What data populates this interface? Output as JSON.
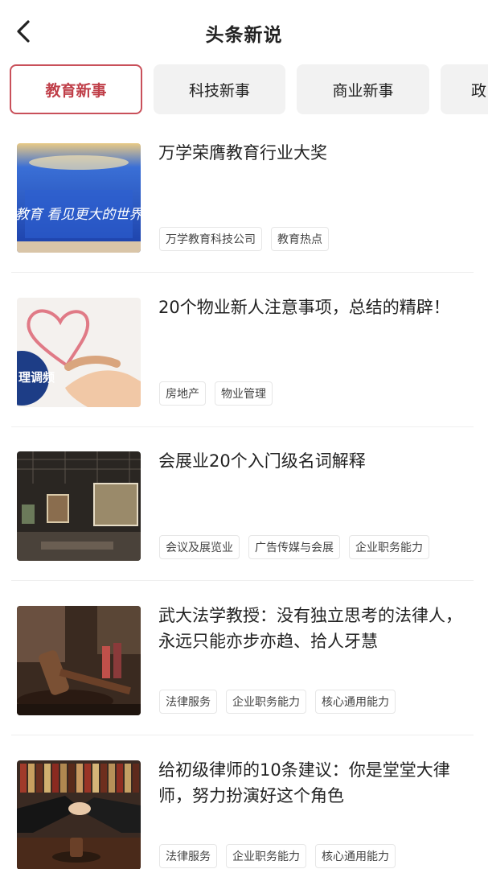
{
  "header": {
    "title": "头条新说",
    "back_icon": "chevron-left-icon"
  },
  "tabs": [
    {
      "label": "教育新事",
      "active": true
    },
    {
      "label": "科技新事",
      "active": false
    },
    {
      "label": "商业新事",
      "active": false
    },
    {
      "label": "政",
      "active": false
    }
  ],
  "articles": [
    {
      "title": "万学荣膺教育行业大奖",
      "tags": [
        "万学教育科技公司",
        "教育热点"
      ],
      "thumb_text": "教育 看见更大的世界"
    },
    {
      "title": "20个物业新人注意事项，总结的精辟！",
      "tags": [
        "房地产",
        "物业管理"
      ],
      "thumb_text": "理调频"
    },
    {
      "title": "会展业20个入门级名词解释",
      "tags": [
        "会议及展览业",
        "广告传媒与会展",
        "企业职务能力"
      ]
    },
    {
      "title": "武大法学教授：没有独立思考的法律人，永远只能亦步亦趋、拾人牙慧",
      "tags": [
        "法律服务",
        "企业职务能力",
        "核心通用能力"
      ]
    },
    {
      "title": "给初级律师的10条建议：你是堂堂大律师，努力扮演好这个角色",
      "tags": [
        "法律服务",
        "企业职务能力",
        "核心通用能力"
      ]
    }
  ],
  "colors": {
    "accent": "#c0404a",
    "tab_bg": "#f2f2f2"
  }
}
